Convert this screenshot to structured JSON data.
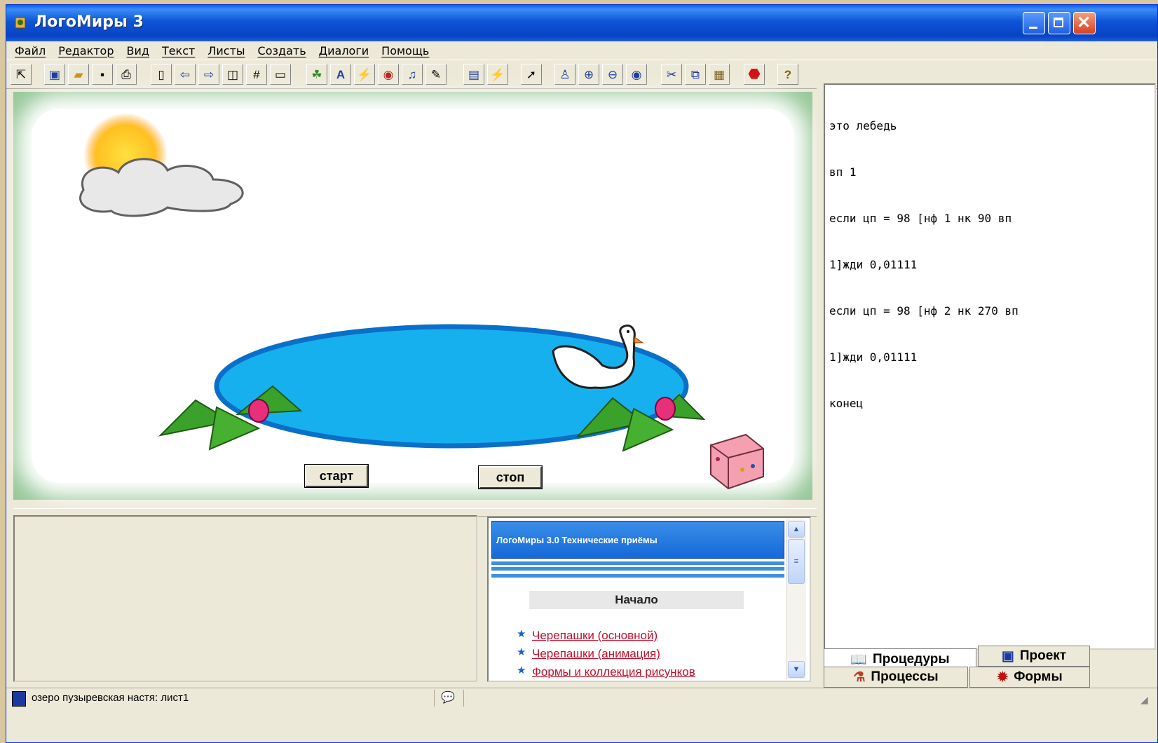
{
  "window": {
    "title": "ЛогоМиры 3"
  },
  "menu": [
    "Файл",
    "Редактор",
    "Вид",
    "Текст",
    "Листы",
    "Создать",
    "Диалоги",
    "Помощь"
  ],
  "canvas": {
    "start_label": "старт",
    "stop_label": "стоп"
  },
  "procedures": {
    "lines": [
      "это лебедь",
      "вп 1",
      "если цп = 98 [нф 1 нк 90 вп",
      "1]жди 0,01111",
      "если цп = 98 [нф 2 нк 270 вп",
      "1]жди 0,01111",
      "конец"
    ]
  },
  "tabs": {
    "procedures": "Процедуры",
    "project": "Проект",
    "processes": "Процессы",
    "forms": "Формы"
  },
  "help": {
    "header": "ЛогоМиры 3.0 Технические приёмы",
    "start": "Начало",
    "links": [
      "Черепашки (основной)",
      "Черепашки (анимация)",
      "Формы и коллекция рисунков"
    ]
  },
  "status": {
    "text": "озеро пузыревская настя:  лист1"
  },
  "colors": {
    "titlebar": "#0a5fe6",
    "pond": "#17b0ef",
    "pond_border": "#0a6fc8",
    "canvas_border": "#98c89a"
  }
}
